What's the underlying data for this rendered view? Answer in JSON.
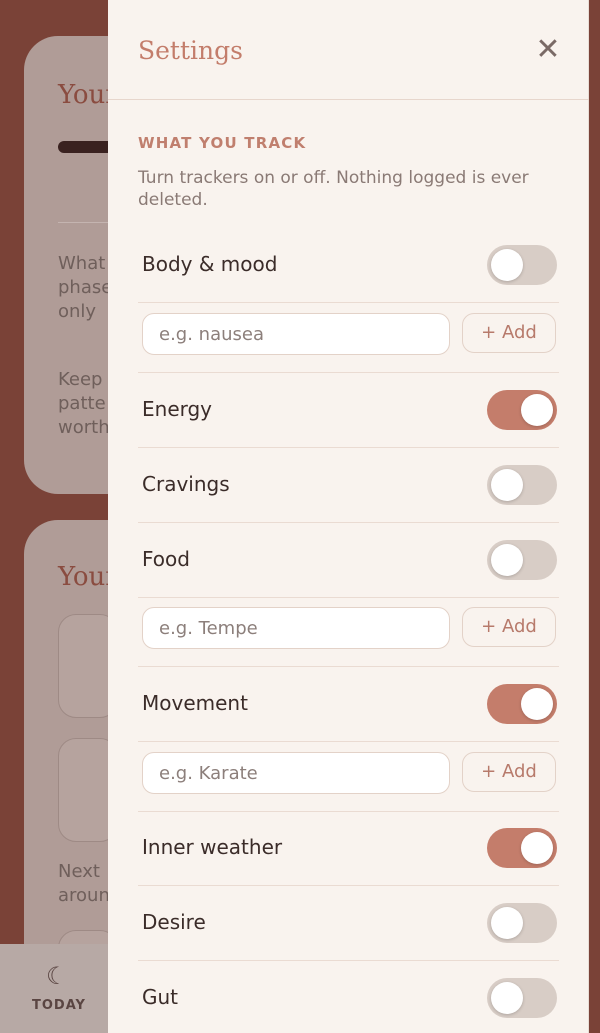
{
  "background": {
    "card1_title": "Your",
    "card1_text1": "What\nphase\nonly",
    "card1_text2": "Keep\npatte\nworth",
    "card2_title": "Your",
    "card2_text": "Next\naroun",
    "nav": {
      "icon": "moon-icon",
      "label": "TODAY"
    }
  },
  "settings": {
    "title": "Settings",
    "close_icon": "close-icon",
    "section_heading": "WHAT YOU TRACK",
    "section_description": "Turn trackers on or off. Nothing logged is ever deleted.",
    "trackers": [
      {
        "label": "Body & mood",
        "enabled": false,
        "input_placeholder": "e.g. nausea",
        "add_label": "+ Add"
      },
      {
        "label": "Energy",
        "enabled": true
      },
      {
        "label": "Cravings",
        "enabled": false
      },
      {
        "label": "Food",
        "enabled": false,
        "input_placeholder": "e.g. Tempe",
        "add_label": "+ Add"
      },
      {
        "label": "Movement",
        "enabled": true,
        "input_placeholder": "e.g. Karate",
        "add_label": "+ Add"
      },
      {
        "label": "Inner weather",
        "enabled": true
      },
      {
        "label": "Desire",
        "enabled": false
      },
      {
        "label": "Gut",
        "enabled": false
      }
    ]
  },
  "colors": {
    "accent": "#c47d6b",
    "toggle_off": "#d8cdc6",
    "sheet_bg": "#f9f3ee"
  }
}
